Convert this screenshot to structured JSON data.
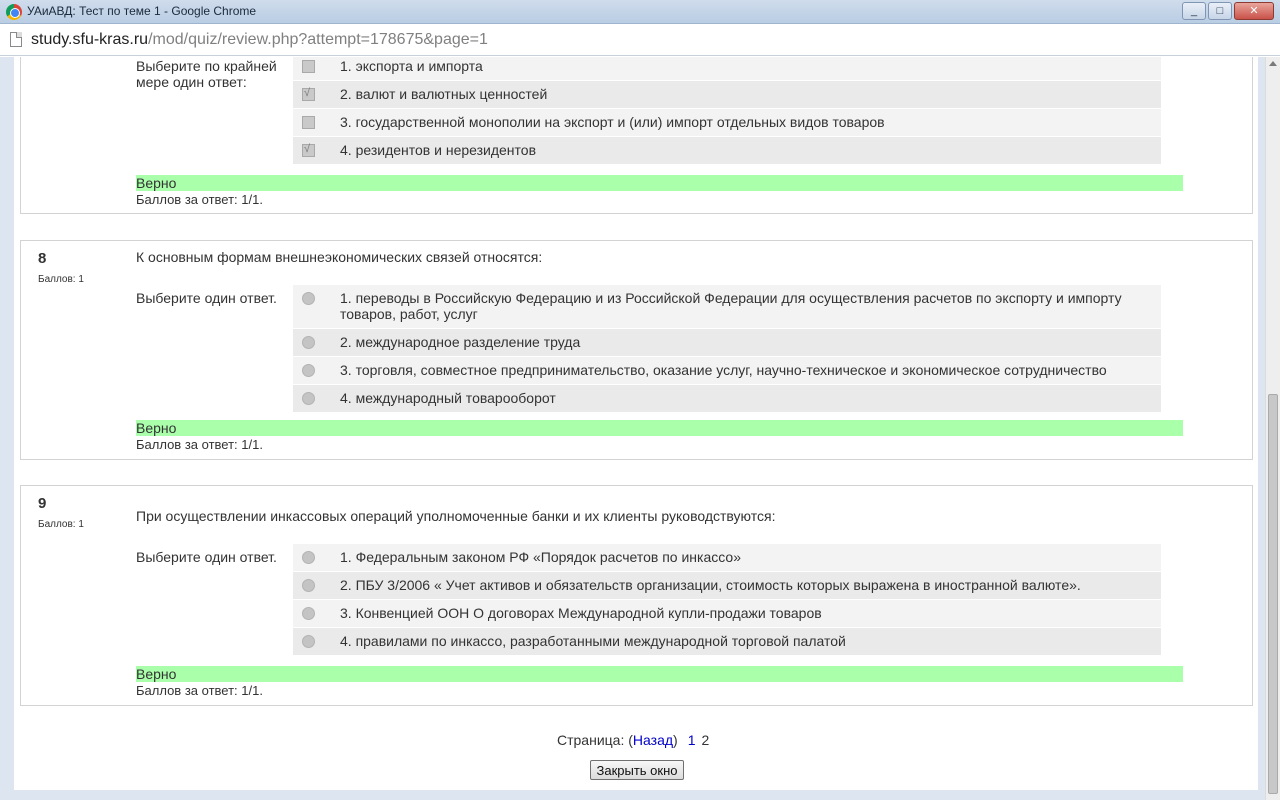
{
  "window": {
    "title": "УАиАВД: Тест по теме 1 - Google Chrome",
    "url_host": "study.sfu-kras.ru",
    "url_path": "/mod/quiz/review.php?attempt=178675&page=1",
    "controls": [
      "_",
      "□",
      "✕"
    ]
  },
  "q7": {
    "prompt": "Выберите по крайней мере один ответ:",
    "answers": [
      {
        "text": "1. экспорта и импорта",
        "checked": false
      },
      {
        "text": "2. валют и валютных ценностей",
        "checked": true
      },
      {
        "text": "3. государственной монополии на экспорт и (или) импорт отдельных видов товаров",
        "checked": false
      },
      {
        "text": "4. резидентов и нерезидентов",
        "checked": true
      }
    ],
    "feedback": "Верно",
    "grade": "Баллов за ответ: 1/1."
  },
  "q8": {
    "number": "8",
    "marks": "Баллов: 1",
    "text": "К основным формам внешнеэкономических связей относятся:",
    "prompt": "Выберите один ответ.",
    "answers": [
      {
        "text": "1. переводы в Российскую Федерацию и из Российской Федерации для осуществления расчетов по экспорту и импорту товаров, работ, услуг"
      },
      {
        "text": "2. международное разделение труда"
      },
      {
        "text": "3. торговля, совместное предпринимательство, оказание услуг, научно-техническое и экономическое сотрудничество"
      },
      {
        "text": "4. международный товарооборот"
      }
    ],
    "feedback": "Верно",
    "grade": "Баллов за ответ: 1/1."
  },
  "q9": {
    "number": "9",
    "marks": "Баллов: 1",
    "text": "При осуществлении инкассовых операций уполномоченные банки и их клиенты руководствуются:",
    "prompt": "Выберите один ответ.",
    "answers": [
      {
        "text": "1. Федеральным законом РФ «Порядок расчетов по инкассо»"
      },
      {
        "text": "2. ПБУ 3/2006 « Учет активов и обязательств организации, стоимость которых выражена в иностранной валюте»."
      },
      {
        "text": "3. Конвенцией ООН О договорах Международной купли-продажи товаров"
      },
      {
        "text": "4. правилами по инкассо, разработанными международной торговой палатой"
      }
    ],
    "feedback": "Верно",
    "grade": "Баллов за ответ: 1/1."
  },
  "paging": {
    "label": "Страница: (",
    "back": "Назад",
    "close_paren": ")",
    "pages": [
      "1",
      "2"
    ]
  },
  "close_button": "Закрыть окно"
}
